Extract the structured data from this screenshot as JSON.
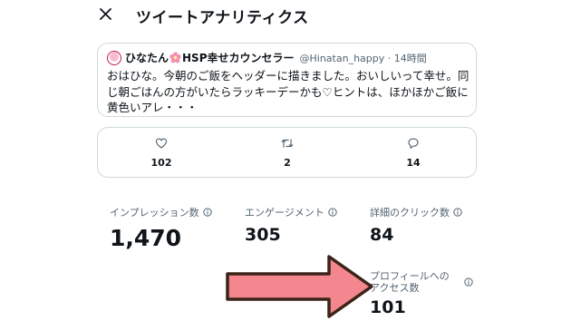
{
  "header": {
    "close_icon": "close-icon",
    "title": "ツイートアナリティクス"
  },
  "tweet": {
    "author_name_part1": "ひなたん",
    "author_name_part2": "HSP幸せカウンセラー",
    "handle_time": "@Hinatan_happy · 14時間",
    "text": "おはひな。今朝のご飯をヘッダーに描きました。おいしいって幸せ。同じ朝ごはんの方がいたらラッキーデーかも♡ヒントは、ほかほかご飯に黄色いアレ・・・"
  },
  "engagement": {
    "likes": "102",
    "retweets": "2",
    "replies": "14"
  },
  "metrics": {
    "impressions_label": "インプレッション数",
    "impressions_value": "1,470",
    "engagements_label": "エンゲージメント",
    "engagements_value": "305",
    "detail_clicks_label": "詳細のクリック数",
    "detail_clicks_value": "84",
    "profile_visits_label": "プロフィールへのアクセス数",
    "profile_visits_value": "101"
  },
  "colors": {
    "arrow_fill": "#f4868f",
    "arrow_stroke": "#3a2418",
    "border": "#cfd9de",
    "secondary_text": "#536471"
  }
}
